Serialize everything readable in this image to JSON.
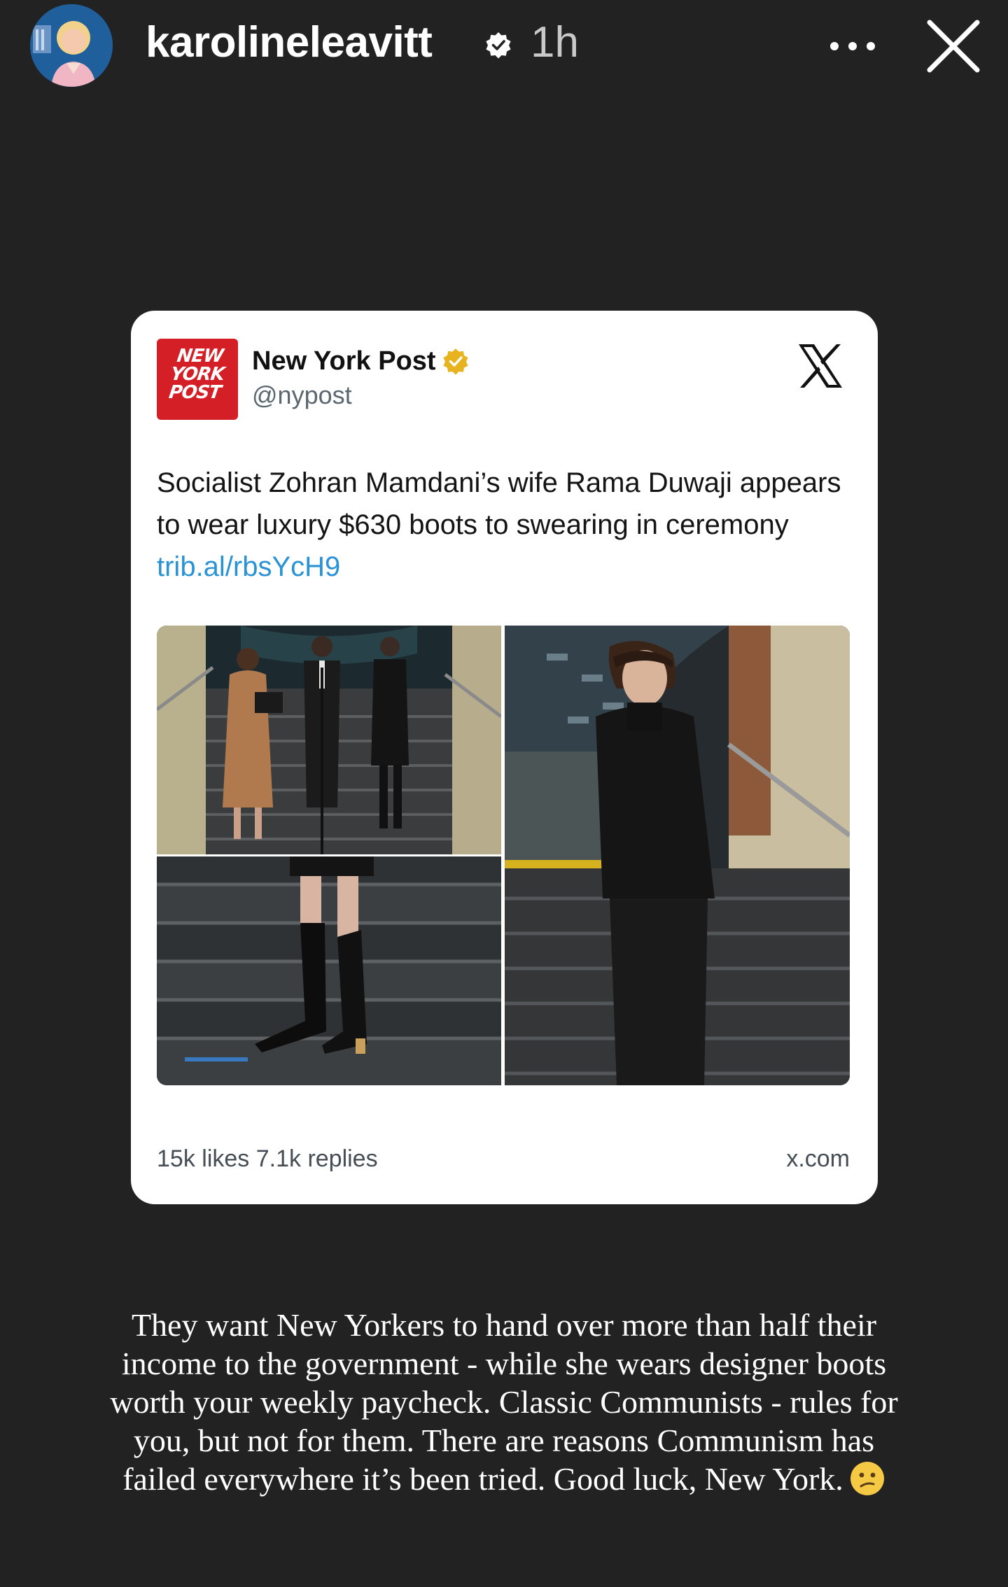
{
  "header": {
    "username": "karolineleavitt",
    "time": "1h",
    "more_icon": "more-horizontal-icon",
    "close_icon": "close-icon"
  },
  "post": {
    "account_name": "New York Post",
    "handle": "@nypost",
    "logo_lines": [
      "NEW",
      "YORK",
      "POST"
    ],
    "platform_icon": "x-logo-icon",
    "text": "Socialist Zohran Mamdani’s wife Rama Duwaji appears to wear luxury $630 boots to swearing in ceremony",
    "link": "trib.al/rbsYcH9",
    "stats": "15k likes  7.1k replies",
    "domain": "x.com",
    "colors": {
      "brand_red": "#d51f26",
      "link_blue": "#2a93d6",
      "gold_badge": "#e8b321"
    }
  },
  "caption": {
    "lines": [
      "They want New Yorkers to hand over more than half their",
      "income to the government - while she wears designer boots",
      "worth your weekly paycheck. Classic Communists - rules for",
      "you, but not for them. There are reasons Communism has",
      "failed everywhere it’s been tried. Good luck, New York."
    ],
    "emoji": "confused-face-emoji"
  }
}
